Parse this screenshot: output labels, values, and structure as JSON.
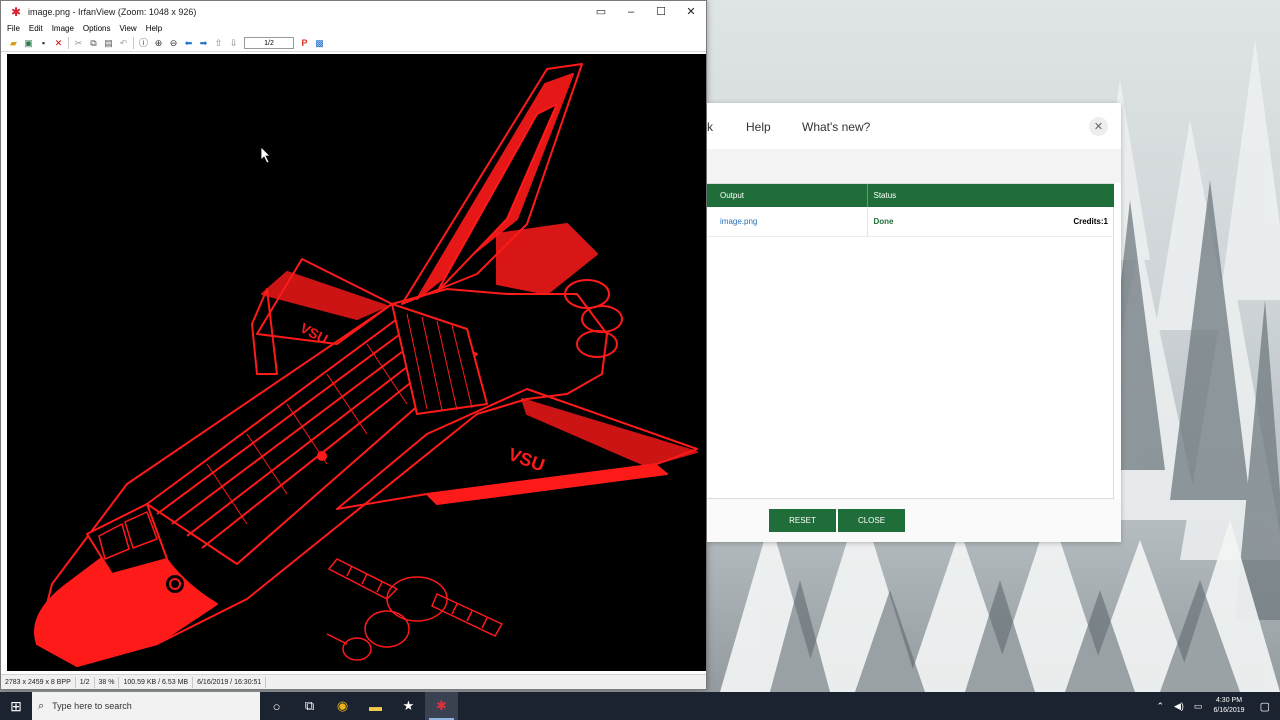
{
  "irfanview": {
    "title": "image.png - IrfanView (Zoom: 1048 x 926)",
    "menu": [
      "File",
      "Edit",
      "Image",
      "Options",
      "View",
      "Help"
    ],
    "page_indicator": "1/2",
    "status": {
      "dimensions": "2783 x 2459 x 8 BPP",
      "page": "1/2",
      "zoom": "38 %",
      "size": "100.59 KB / 6.53 MB",
      "datetime": "6/16/2019 / 16:30:51"
    },
    "image_text": {
      "wing_logo": "VSU",
      "tail_logo": "VSU"
    }
  },
  "converter": {
    "nav": {
      "partial": "k",
      "help": "Help",
      "whats_new": "What's new?"
    },
    "table": {
      "headers": {
        "output": "Output",
        "status": "Status"
      },
      "row": {
        "output": "image.png",
        "status": "Done",
        "credits": "Credits:1"
      }
    },
    "buttons": {
      "reset": "RESET",
      "close": "CLOSE"
    }
  },
  "taskbar": {
    "search_placeholder": "Type here to search",
    "time": "4:30 PM",
    "date": "6/16/2019"
  },
  "colors": {
    "shuttle_red": "#ff1a1a",
    "converter_green": "#1f6e3a",
    "taskbar": "#1c2330"
  }
}
